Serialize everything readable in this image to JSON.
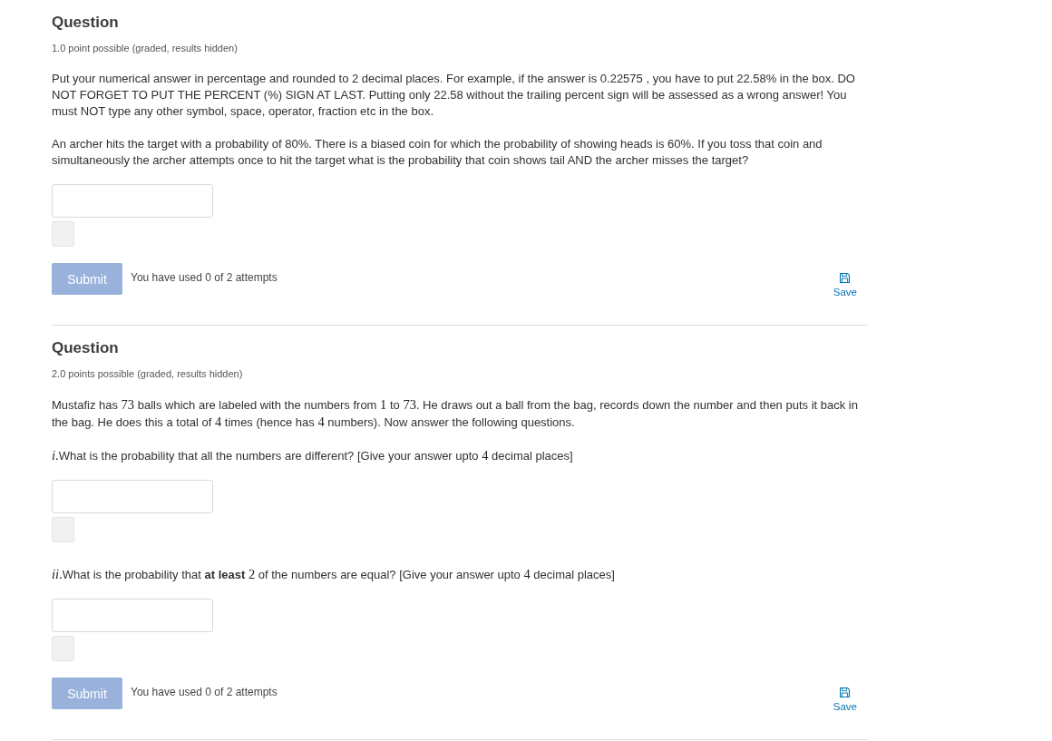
{
  "problems": [
    {
      "title": "Question",
      "points": "1.0 point possible (graded, results hidden)",
      "blocks": [
        {
          "kind": "paragraph",
          "segments": [
            {
              "kind": "text",
              "text": "Put your numerical answer in percentage and rounded to 2 decimal places. For example, if the answer is 0.22575 , you have to put 22.58% in the box. DO NOT FORGET TO PUT THE PERCENT (%) SIGN AT LAST. Putting only 22.58 without the trailing percent sign will be assessed as a wrong answer! You must NOT type any other symbol, space, operator, fraction etc in the box."
            }
          ]
        },
        {
          "kind": "paragraph",
          "segments": [
            {
              "kind": "text",
              "text": "An archer hits the target with a probability of 80%. There is a biased coin for which the probability of showing heads is 60%. If you toss that coin and simultaneously the archer attempts once to hit the target what is the probability that coin shows tail AND the archer misses the target?"
            }
          ]
        },
        {
          "kind": "answer"
        }
      ],
      "submit": {
        "label": "Submit",
        "disabled": true
      },
      "attempts": "You have used 0 of 2 attempts",
      "save": {
        "label": "Save"
      }
    },
    {
      "title": "Question",
      "points": "2.0 points possible (graded, results hidden)",
      "blocks": [
        {
          "kind": "paragraph",
          "segments": [
            {
              "kind": "text",
              "text": "Mustafiz has "
            },
            {
              "kind": "math",
              "text": "73"
            },
            {
              "kind": "text",
              "text": " balls which are labeled with the numbers from "
            },
            {
              "kind": "math",
              "text": "1"
            },
            {
              "kind": "text",
              "text": " to "
            },
            {
              "kind": "math",
              "text": "73"
            },
            {
              "kind": "text",
              "text": ". He draws out a ball from the bag, records down the number and then puts it back in the bag. He does this a total of "
            },
            {
              "kind": "math",
              "text": "4"
            },
            {
              "kind": "text",
              "text": " times (hence has "
            },
            {
              "kind": "math",
              "text": "4"
            },
            {
              "kind": "text",
              "text": " numbers). Now answer the following questions."
            }
          ]
        },
        {
          "kind": "paragraph",
          "segments": [
            {
              "kind": "math",
              "text": "*i*."
            },
            {
              "kind": "text",
              "text": "What is the probability that all the numbers are different? [Give your answer upto "
            },
            {
              "kind": "math",
              "text": "4"
            },
            {
              "kind": "text",
              "text": " decimal places]"
            }
          ]
        },
        {
          "kind": "answer"
        },
        {
          "kind": "paragraph",
          "segments": [
            {
              "kind": "math",
              "text": "*ii*."
            },
            {
              "kind": "text",
              "text": "What is the probability that **at least** "
            },
            {
              "kind": "math",
              "text": "2"
            },
            {
              "kind": "text",
              "text": " of the numbers are equal? [Give your answer upto "
            },
            {
              "kind": "math",
              "text": "4"
            },
            {
              "kind": "text",
              "text": " decimal places]"
            }
          ]
        },
        {
          "kind": "answer"
        }
      ],
      "submit": {
        "label": "Submit",
        "disabled": true
      },
      "attempts": "You have used 0 of 2 attempts",
      "save": {
        "label": "Save"
      }
    }
  ]
}
